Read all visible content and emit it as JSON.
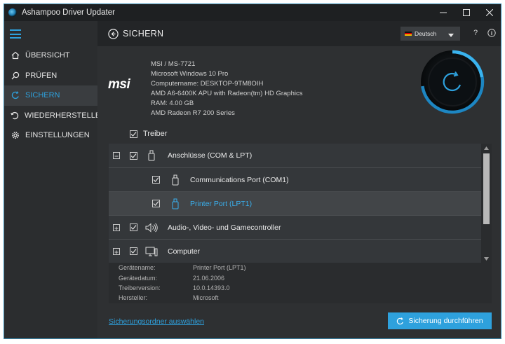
{
  "window": {
    "title": "Ashampoo Driver Updater",
    "minimize_icon": "minimize-icon",
    "maximize_icon": "maximize-icon",
    "close_icon": "close-icon"
  },
  "sidebar": {
    "menu_icon": "hamburger-icon",
    "items": [
      {
        "label": "ÜBERSICHT",
        "icon": "home-icon",
        "active": false
      },
      {
        "label": "PRÜFEN",
        "icon": "search-icon",
        "active": false
      },
      {
        "label": "SICHERN",
        "icon": "refresh-icon",
        "active": true
      },
      {
        "label": "WIEDERHERSTELLEN",
        "icon": "restore-icon",
        "active": false
      },
      {
        "label": "EINSTELLUNGEN",
        "icon": "gear-icon",
        "active": false
      }
    ]
  },
  "header": {
    "back_icon": "back-arrow-icon",
    "title": "SICHERN",
    "language": {
      "label": "Deutsch",
      "flag": "german-flag-icon"
    },
    "help_icon": "help-icon",
    "help_glyph": "?",
    "info_icon": "info-icon"
  },
  "system_info": {
    "brand_logo": "msi",
    "lines": [
      "MSI / MS-7721",
      "Microsoft Windows 10 Pro",
      "Computername: DESKTOP-9TM8OIH",
      "AMD A6-6400K APU with Radeon(tm) HD Graphics",
      "RAM: 4.00 GB",
      "AMD Radeon R7 200 Series"
    ]
  },
  "tree": {
    "header_label": "Treiber",
    "rows": [
      {
        "label": "Anschlüsse (COM & LPT)",
        "level": 0,
        "expander": "minus",
        "checked": true,
        "icon": "usb-device-icon",
        "highlighted": false
      },
      {
        "label": "Communications Port (COM1)",
        "level": 1,
        "expander": "",
        "checked": true,
        "icon": "usb-device-icon",
        "highlighted": false
      },
      {
        "label": "Printer Port (LPT1)",
        "level": 1,
        "expander": "",
        "checked": true,
        "icon": "usb-device-icon",
        "highlighted": true
      },
      {
        "label": "Audio-, Video- und Gamecontroller",
        "level": 0,
        "expander": "plus",
        "checked": true,
        "icon": "speaker-icon",
        "highlighted": false
      },
      {
        "label": "Computer",
        "level": 0,
        "expander": "plus",
        "checked": true,
        "icon": "computer-icon",
        "highlighted": false
      }
    ]
  },
  "details": [
    {
      "key": "Gerätename:",
      "value": "Printer Port (LPT1)"
    },
    {
      "key": "Gerätedatum:",
      "value": "21.06.2006"
    },
    {
      "key": "Treiberversion:",
      "value": "10.0.14393.0"
    },
    {
      "key": "Hersteller:",
      "value": "Microsoft"
    }
  ],
  "footer": {
    "folder_link": "Sicherungsordner auswählen",
    "action_button": "Sicherung durchführen",
    "action_icon": "refresh-icon"
  },
  "colors": {
    "accent": "#2ea1dd",
    "background": "#2e3032",
    "sidebar": "#2b2d2f",
    "titlebar": "#1e2022"
  }
}
